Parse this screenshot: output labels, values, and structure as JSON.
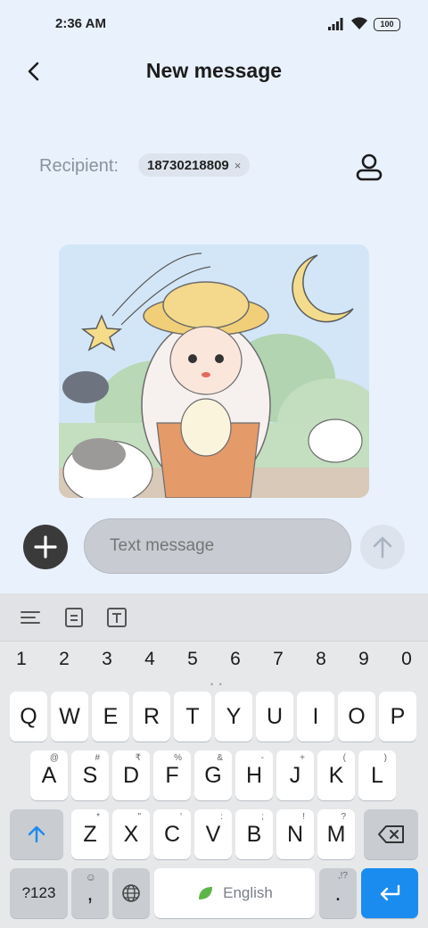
{
  "status_bar": {
    "time": "2:36 AM",
    "battery": "100"
  },
  "header": {
    "title": "New message"
  },
  "recipient": {
    "label": "Recipient:",
    "chip_number": "18730218809",
    "chip_remove": "×"
  },
  "compose": {
    "placeholder": "Text message"
  },
  "keyboard": {
    "numbers": [
      "1",
      "2",
      "3",
      "4",
      "5",
      "6",
      "7",
      "8",
      "9",
      "0"
    ],
    "row1": [
      "Q",
      "W",
      "E",
      "R",
      "T",
      "Y",
      "U",
      "I",
      "O",
      "P"
    ],
    "row2": [
      "A",
      "S",
      "D",
      "F",
      "G",
      "H",
      "J",
      "K",
      "L"
    ],
    "row2_hints": [
      "@",
      "#",
      "₹",
      "%",
      "&",
      "-",
      "+",
      "(",
      ")"
    ],
    "row3": [
      "Z",
      "X",
      "C",
      "V",
      "B",
      "N",
      "M"
    ],
    "row3_hints": [
      "*",
      "\"",
      "'",
      ":",
      ";",
      "!",
      "?"
    ],
    "symbols_label": "?123",
    "comma": ",",
    "space_label": "English",
    "period": ".",
    "period_hint": ",!?"
  },
  "colors": {
    "accent": "#1a8cf0",
    "background": "#e9f1fd",
    "keyboard": "#e6e8ea"
  }
}
